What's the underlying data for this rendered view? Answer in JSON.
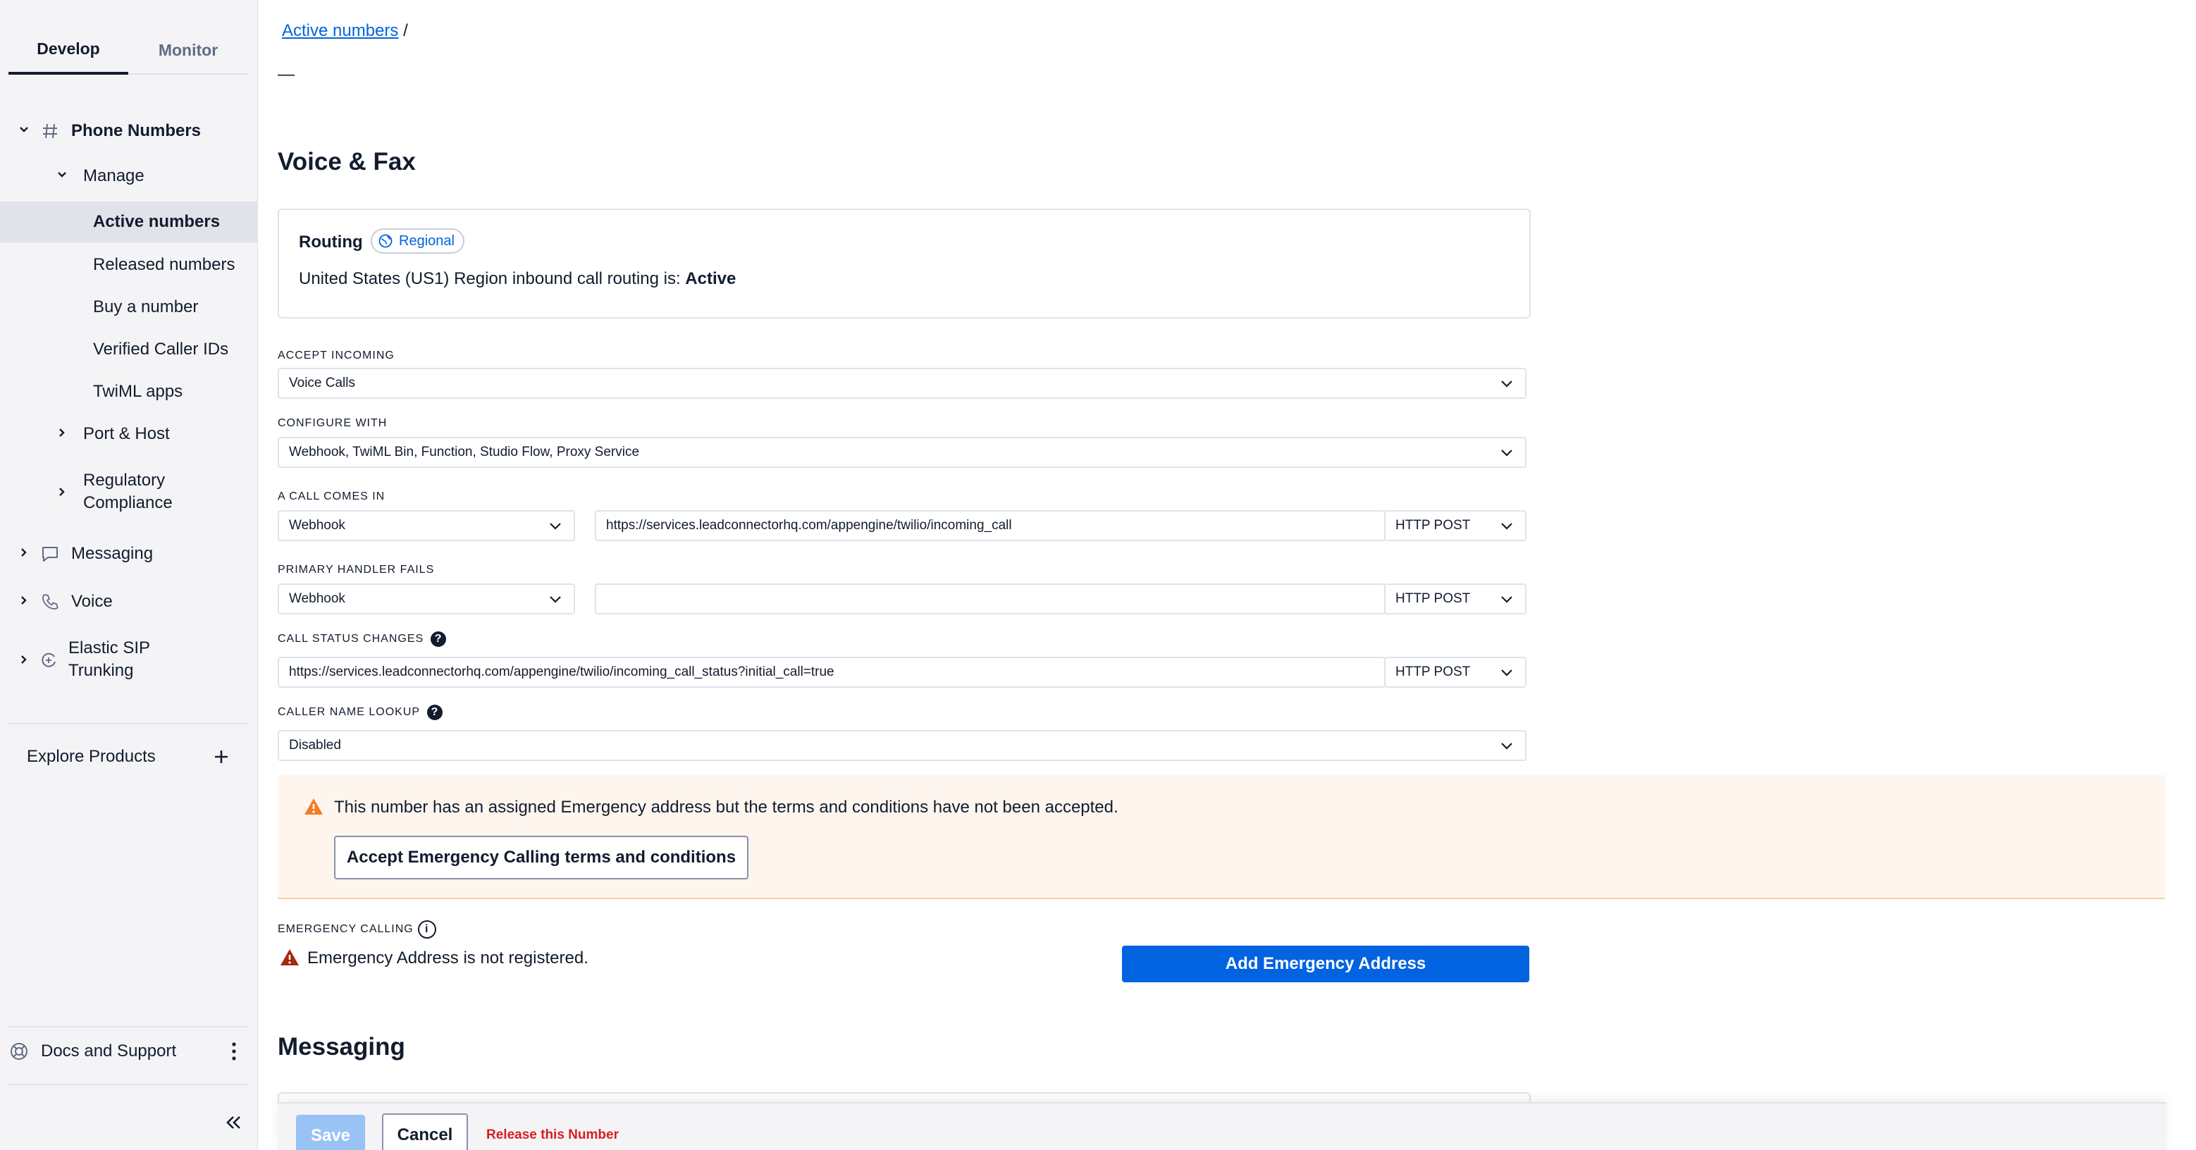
{
  "sidebar": {
    "tabs": [
      {
        "label": "Develop",
        "active": true
      },
      {
        "label": "Monitor",
        "active": false
      }
    ],
    "phone_numbers": "Phone Numbers",
    "manage": "Manage",
    "items": {
      "active_numbers": "Active numbers",
      "released_numbers": "Released numbers",
      "buy_number": "Buy a number",
      "verified_caller_ids": "Verified Caller IDs",
      "twiml_apps": "TwiML apps",
      "port_host": "Port & Host",
      "regulatory_line1": "Regulatory",
      "regulatory_line2": "Compliance"
    },
    "messaging": "Messaging",
    "voice": "Voice",
    "elastic_line1": "Elastic SIP",
    "elastic_line2": "Trunking",
    "explore_products": "Explore Products",
    "docs_support": "Docs and Support"
  },
  "breadcrumb": {
    "link": "Active numbers",
    "separator": "/"
  },
  "notes_dash": "—",
  "voice_fax": {
    "title": "Voice & Fax",
    "routing": {
      "title": "Routing",
      "badge": "Regional",
      "text_prefix": "United States (US1) Region inbound call routing is: ",
      "status": "Active"
    },
    "accept_incoming": {
      "label": "ACCEPT INCOMING",
      "value": "Voice Calls"
    },
    "configure_with": {
      "label": "CONFIGURE WITH",
      "value": "Webhook, TwiML Bin, Function, Studio Flow, Proxy Service"
    },
    "call_comes_in": {
      "label": "A CALL COMES IN",
      "type": "Webhook",
      "url": "https://services.leadconnectorhq.com/appengine/twilio/incoming_call",
      "method": "HTTP POST"
    },
    "primary_handler_fails": {
      "label": "PRIMARY HANDLER FAILS",
      "type": "Webhook",
      "url": "",
      "method": "HTTP POST"
    },
    "call_status_changes": {
      "label": "CALL STATUS CHANGES",
      "url": "https://services.leadconnectorhq.com/appengine/twilio/incoming_call_status?initial_call=true",
      "method": "HTTP POST"
    },
    "caller_name_lookup": {
      "label": "CALLER NAME LOOKUP",
      "value": "Disabled"
    }
  },
  "alert": {
    "text": "This number has an assigned Emergency address but the terms and conditions have not been accepted.",
    "button": "Accept Emergency Calling terms and conditions"
  },
  "emergency": {
    "label": "EMERGENCY CALLING",
    "status_text": "Emergency Address is not registered.",
    "button": "Add Emergency Address"
  },
  "messaging": {
    "title": "Messaging"
  },
  "footer": {
    "save": "Save",
    "cancel": "Cancel",
    "release": "Release this Number"
  },
  "colors": {
    "accent": "#0263e0",
    "danger": "#d61f1f",
    "warning": "#f47c22",
    "alert_bg": "#fef5ee"
  }
}
